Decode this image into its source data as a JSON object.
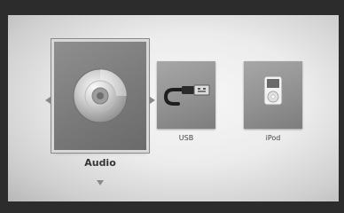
{
  "menu": {
    "items": [
      {
        "label": "Audio",
        "icon": "disc-icon",
        "selected": true
      },
      {
        "label": "USB",
        "icon": "usb-cable-icon",
        "selected": false
      },
      {
        "label": "iPod",
        "icon": "ipod-icon",
        "selected": false
      }
    ]
  },
  "colors": {
    "background": "#ececec",
    "frame": "#2c2c2c",
    "tile": "#8f8f8f",
    "selected_border": "#d8d8d8"
  }
}
